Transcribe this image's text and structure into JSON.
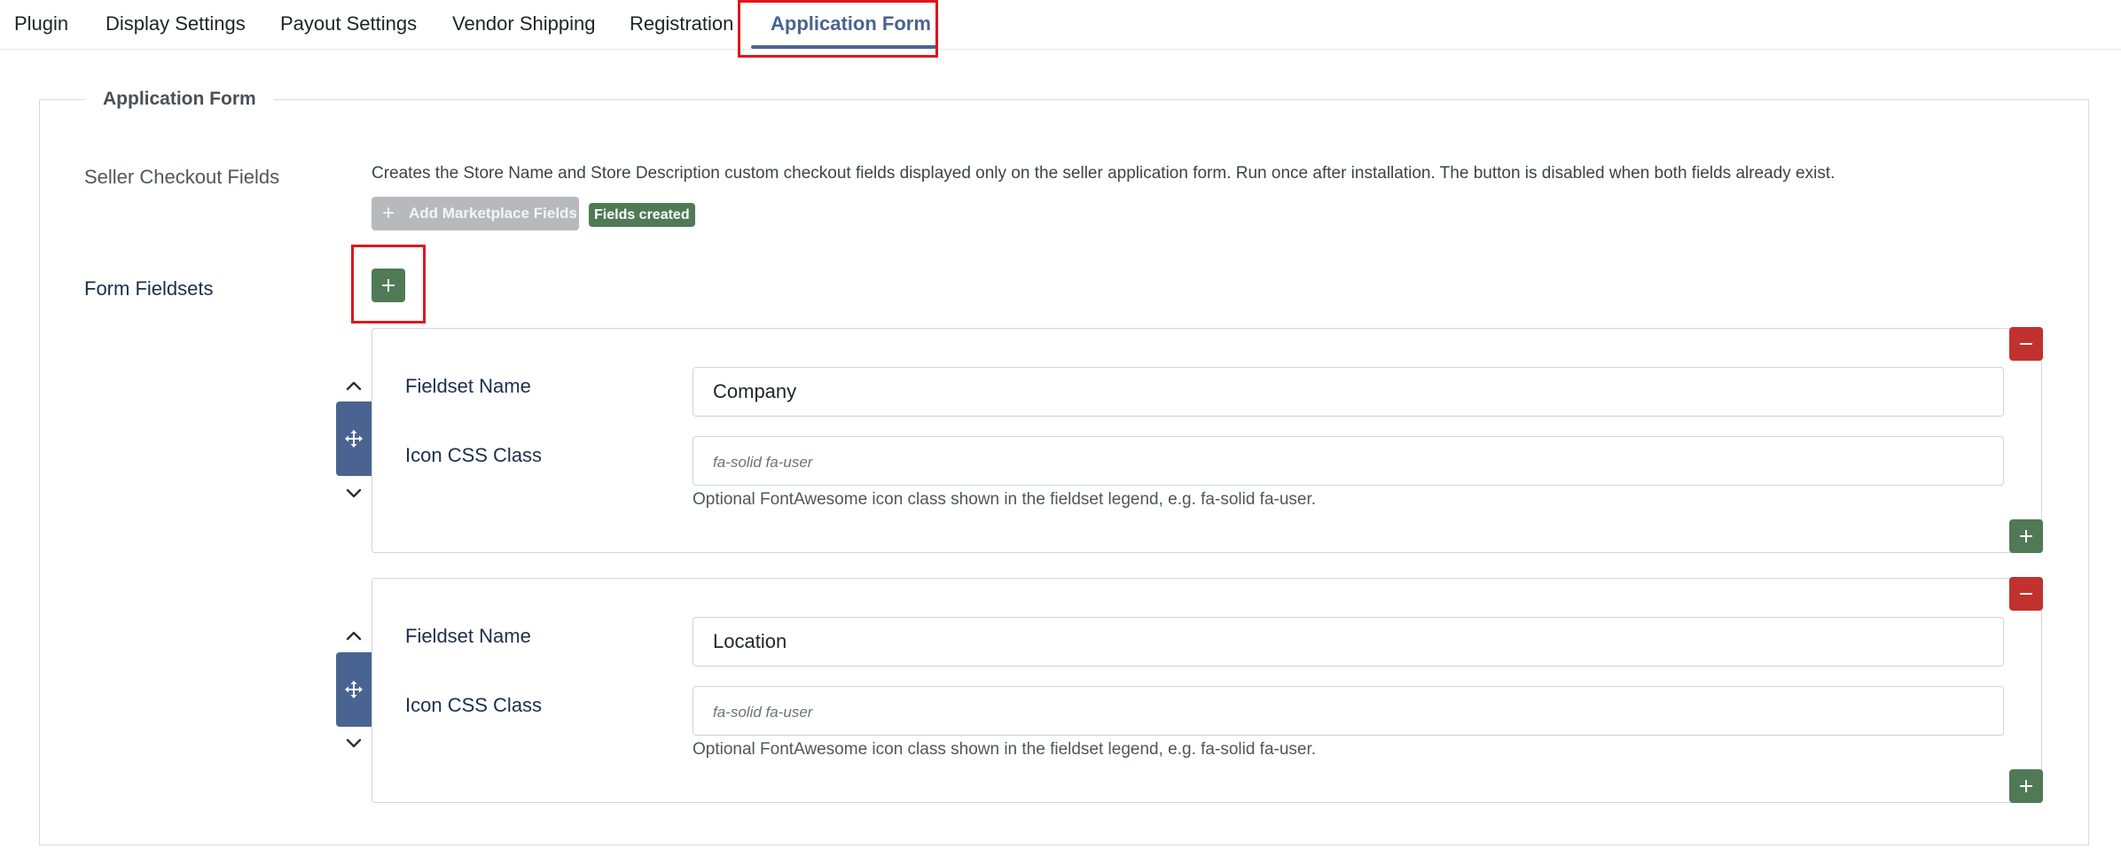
{
  "tabs": [
    {
      "label": "Plugin"
    },
    {
      "label": "Display Settings"
    },
    {
      "label": "Payout Settings"
    },
    {
      "label": "Vendor Shipping"
    },
    {
      "label": "Registration"
    },
    {
      "label": "Application Form",
      "active": true
    }
  ],
  "section": {
    "legend": "Application Form"
  },
  "seller_checkout": {
    "label": "Seller Checkout Fields",
    "description": "Creates the Store Name and Store Description custom checkout fields displayed only on the seller application form. Run once after installation. The button is disabled when both fields already exist.",
    "button_label": "Add Marketplace Fields",
    "badge": "Fields created"
  },
  "form_fieldsets": {
    "label": "Form Fieldsets",
    "items": [
      {
        "name_label": "Fieldset Name",
        "name_value": "Company",
        "icon_label": "Icon CSS Class",
        "icon_value": "",
        "icon_placeholder": "fa-solid fa-user",
        "help": "Optional FontAwesome icon class shown in the fieldset legend, e.g. fa-solid fa-user."
      },
      {
        "name_label": "Fieldset Name",
        "name_value": "Location",
        "icon_label": "Icon CSS Class",
        "icon_value": "",
        "icon_placeholder": "fa-solid fa-user",
        "help": "Optional FontAwesome icon class shown in the fieldset legend, e.g. fa-solid fa-user."
      }
    ]
  },
  "colors": {
    "accent": "#4a6491",
    "success": "#4f7a55",
    "danger": "#c1312e",
    "highlight": "#e0161b"
  },
  "icons": {
    "add": "plus-icon",
    "remove": "minus-icon",
    "move": "move-arrows-icon",
    "up": "chevron-up-icon",
    "down": "chevron-down-icon"
  }
}
